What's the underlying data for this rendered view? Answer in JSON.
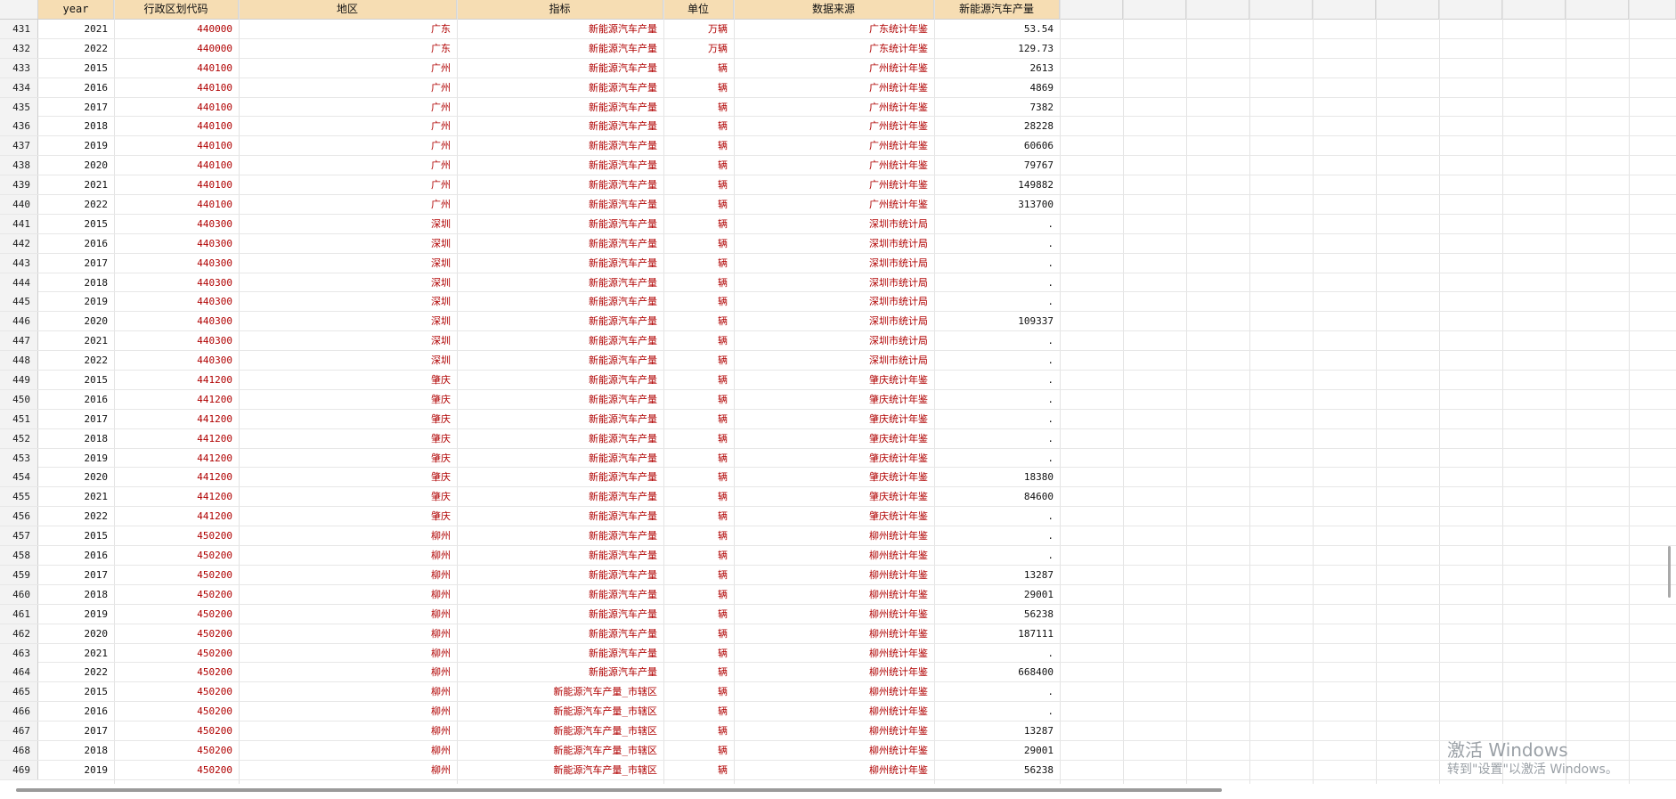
{
  "columns": [
    "year",
    "行政区划代码",
    "地区",
    "指标",
    "单位",
    "数据来源",
    "新能源汽车产量"
  ],
  "rows": [
    [
      "431",
      "2021",
      "440000",
      "广东",
      "新能源汽车产量",
      "万辆",
      "广东统计年鉴",
      "53.54"
    ],
    [
      "432",
      "2022",
      "440000",
      "广东",
      "新能源汽车产量",
      "万辆",
      "广东统计年鉴",
      "129.73"
    ],
    [
      "433",
      "2015",
      "440100",
      "广州",
      "新能源汽车产量",
      "辆",
      "广州统计年鉴",
      "2613"
    ],
    [
      "434",
      "2016",
      "440100",
      "广州",
      "新能源汽车产量",
      "辆",
      "广州统计年鉴",
      "4869"
    ],
    [
      "435",
      "2017",
      "440100",
      "广州",
      "新能源汽车产量",
      "辆",
      "广州统计年鉴",
      "7382"
    ],
    [
      "436",
      "2018",
      "440100",
      "广州",
      "新能源汽车产量",
      "辆",
      "广州统计年鉴",
      "28228"
    ],
    [
      "437",
      "2019",
      "440100",
      "广州",
      "新能源汽车产量",
      "辆",
      "广州统计年鉴",
      "60606"
    ],
    [
      "438",
      "2020",
      "440100",
      "广州",
      "新能源汽车产量",
      "辆",
      "广州统计年鉴",
      "79767"
    ],
    [
      "439",
      "2021",
      "440100",
      "广州",
      "新能源汽车产量",
      "辆",
      "广州统计年鉴",
      "149882"
    ],
    [
      "440",
      "2022",
      "440100",
      "广州",
      "新能源汽车产量",
      "辆",
      "广州统计年鉴",
      "313700"
    ],
    [
      "441",
      "2015",
      "440300",
      "深圳",
      "新能源汽车产量",
      "辆",
      "深圳市统计局",
      "."
    ],
    [
      "442",
      "2016",
      "440300",
      "深圳",
      "新能源汽车产量",
      "辆",
      "深圳市统计局",
      "."
    ],
    [
      "443",
      "2017",
      "440300",
      "深圳",
      "新能源汽车产量",
      "辆",
      "深圳市统计局",
      "."
    ],
    [
      "444",
      "2018",
      "440300",
      "深圳",
      "新能源汽车产量",
      "辆",
      "深圳市统计局",
      "."
    ],
    [
      "445",
      "2019",
      "440300",
      "深圳",
      "新能源汽车产量",
      "辆",
      "深圳市统计局",
      "."
    ],
    [
      "446",
      "2020",
      "440300",
      "深圳",
      "新能源汽车产量",
      "辆",
      "深圳市统计局",
      "109337"
    ],
    [
      "447",
      "2021",
      "440300",
      "深圳",
      "新能源汽车产量",
      "辆",
      "深圳市统计局",
      "."
    ],
    [
      "448",
      "2022",
      "440300",
      "深圳",
      "新能源汽车产量",
      "辆",
      "深圳市统计局",
      "."
    ],
    [
      "449",
      "2015",
      "441200",
      "肇庆",
      "新能源汽车产量",
      "辆",
      "肇庆统计年鉴",
      "."
    ],
    [
      "450",
      "2016",
      "441200",
      "肇庆",
      "新能源汽车产量",
      "辆",
      "肇庆统计年鉴",
      "."
    ],
    [
      "451",
      "2017",
      "441200",
      "肇庆",
      "新能源汽车产量",
      "辆",
      "肇庆统计年鉴",
      "."
    ],
    [
      "452",
      "2018",
      "441200",
      "肇庆",
      "新能源汽车产量",
      "辆",
      "肇庆统计年鉴",
      "."
    ],
    [
      "453",
      "2019",
      "441200",
      "肇庆",
      "新能源汽车产量",
      "辆",
      "肇庆统计年鉴",
      "."
    ],
    [
      "454",
      "2020",
      "441200",
      "肇庆",
      "新能源汽车产量",
      "辆",
      "肇庆统计年鉴",
      "18380"
    ],
    [
      "455",
      "2021",
      "441200",
      "肇庆",
      "新能源汽车产量",
      "辆",
      "肇庆统计年鉴",
      "84600"
    ],
    [
      "456",
      "2022",
      "441200",
      "肇庆",
      "新能源汽车产量",
      "辆",
      "肇庆统计年鉴",
      "."
    ],
    [
      "457",
      "2015",
      "450200",
      "柳州",
      "新能源汽车产量",
      "辆",
      "柳州统计年鉴",
      "."
    ],
    [
      "458",
      "2016",
      "450200",
      "柳州",
      "新能源汽车产量",
      "辆",
      "柳州统计年鉴",
      "."
    ],
    [
      "459",
      "2017",
      "450200",
      "柳州",
      "新能源汽车产量",
      "辆",
      "柳州统计年鉴",
      "13287"
    ],
    [
      "460",
      "2018",
      "450200",
      "柳州",
      "新能源汽车产量",
      "辆",
      "柳州统计年鉴",
      "29001"
    ],
    [
      "461",
      "2019",
      "450200",
      "柳州",
      "新能源汽车产量",
      "辆",
      "柳州统计年鉴",
      "56238"
    ],
    [
      "462",
      "2020",
      "450200",
      "柳州",
      "新能源汽车产量",
      "辆",
      "柳州统计年鉴",
      "187111"
    ],
    [
      "463",
      "2021",
      "450200",
      "柳州",
      "新能源汽车产量",
      "辆",
      "柳州统计年鉴",
      "."
    ],
    [
      "464",
      "2022",
      "450200",
      "柳州",
      "新能源汽车产量",
      "辆",
      "柳州统计年鉴",
      "668400"
    ],
    [
      "465",
      "2015",
      "450200",
      "柳州",
      "新能源汽车产量_市辖区",
      "辆",
      "柳州统计年鉴",
      "."
    ],
    [
      "466",
      "2016",
      "450200",
      "柳州",
      "新能源汽车产量_市辖区",
      "辆",
      "柳州统计年鉴",
      "."
    ],
    [
      "467",
      "2017",
      "450200",
      "柳州",
      "新能源汽车产量_市辖区",
      "辆",
      "柳州统计年鉴",
      "13287"
    ],
    [
      "468",
      "2018",
      "450200",
      "柳州",
      "新能源汽车产量_市辖区",
      "辆",
      "柳州统计年鉴",
      "29001"
    ],
    [
      "469",
      "2019",
      "450200",
      "柳州",
      "新能源汽车产量_市辖区",
      "辆",
      "柳州统计年鉴",
      "56238"
    ]
  ],
  "watermark": {
    "line1": "激活 Windows",
    "line2": "转到\"设置\"以激活 Windows。"
  }
}
